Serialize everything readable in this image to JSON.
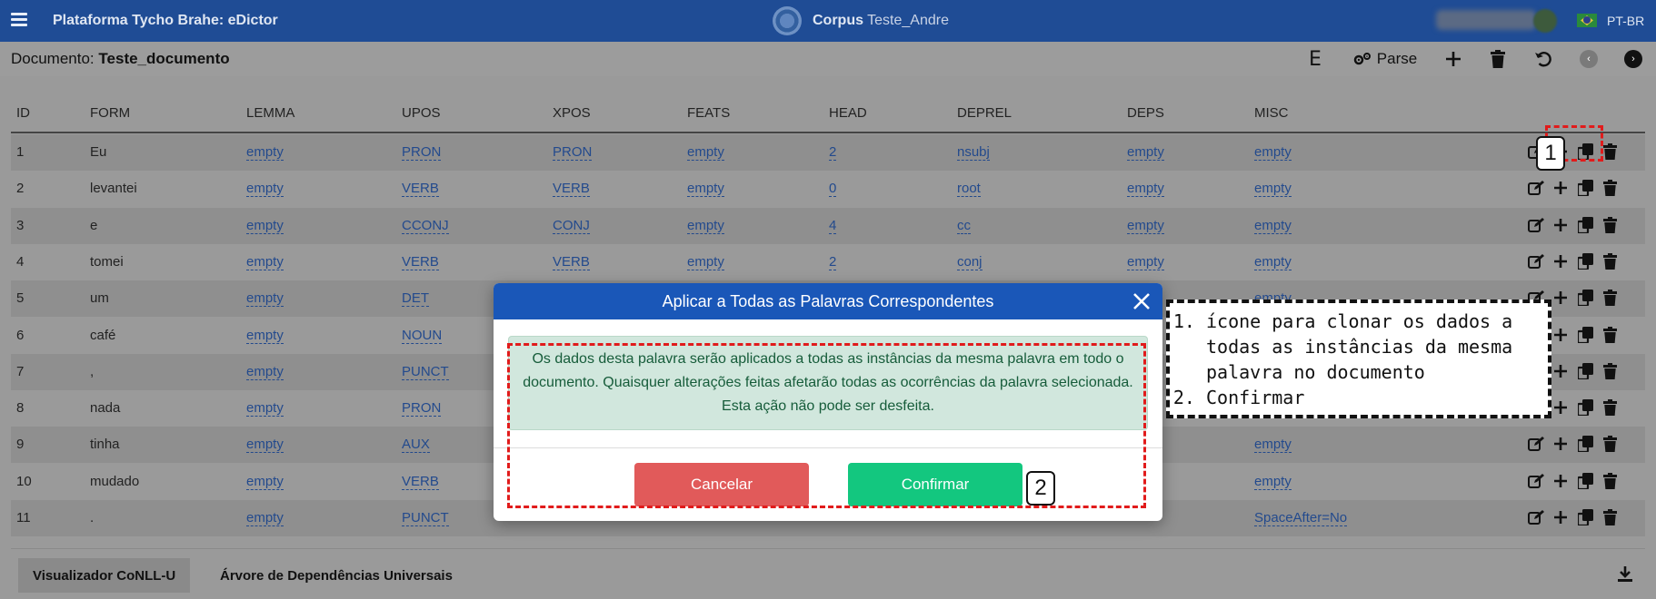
{
  "navbar": {
    "brand": "Plataforma Tycho Brahe: eDictor",
    "corpus_label": "Corpus",
    "corpus_name": "Teste_Andre",
    "lang": "PT-BR"
  },
  "document": {
    "label": "Documento:",
    "name": "Teste_documento"
  },
  "toolbar": {
    "e_label": "E",
    "parse_label": "Parse"
  },
  "table": {
    "headers": [
      "ID",
      "FORM",
      "LEMMA",
      "UPOS",
      "XPOS",
      "FEATS",
      "HEAD",
      "DEPREL",
      "DEPS",
      "MISC"
    ],
    "rows": [
      {
        "id": "1",
        "form": "Eu",
        "lemma": "empty",
        "upos": "PRON",
        "xpos": "PRON",
        "feats": "empty",
        "head": "2",
        "deprel": "nsubj",
        "deps": "empty",
        "misc": "empty"
      },
      {
        "id": "2",
        "form": "levantei",
        "lemma": "empty",
        "upos": "VERB",
        "xpos": "VERB",
        "feats": "empty",
        "head": "0",
        "deprel": "root",
        "deps": "empty",
        "misc": "empty"
      },
      {
        "id": "3",
        "form": "e",
        "lemma": "empty",
        "upos": "CCONJ",
        "xpos": "CONJ",
        "feats": "empty",
        "head": "4",
        "deprel": "cc",
        "deps": "empty",
        "misc": "empty"
      },
      {
        "id": "4",
        "form": "tomei",
        "lemma": "empty",
        "upos": "VERB",
        "xpos": "VERB",
        "feats": "empty",
        "head": "2",
        "deprel": "conj",
        "deps": "empty",
        "misc": "empty"
      },
      {
        "id": "5",
        "form": "um",
        "lemma": "empty",
        "upos": "DET",
        "xpos": "",
        "feats": "",
        "head": "",
        "deprel": "",
        "deps": "",
        "misc": "empty"
      },
      {
        "id": "6",
        "form": "café",
        "lemma": "empty",
        "upos": "NOUN",
        "xpos": "",
        "feats": "",
        "head": "",
        "deprel": "",
        "deps": "",
        "misc": ""
      },
      {
        "id": "7",
        "form": ",",
        "lemma": "empty",
        "upos": "PUNCT",
        "xpos": "",
        "feats": "",
        "head": "",
        "deprel": "",
        "deps": "",
        "misc": ""
      },
      {
        "id": "8",
        "form": "nada",
        "lemma": "empty",
        "upos": "PRON",
        "xpos": "",
        "feats": "",
        "head": "",
        "deprel": "",
        "deps": "",
        "misc": ""
      },
      {
        "id": "9",
        "form": "tinha",
        "lemma": "empty",
        "upos": "AUX",
        "xpos": "",
        "feats": "",
        "head": "",
        "deprel": "",
        "deps": "",
        "misc": "empty"
      },
      {
        "id": "10",
        "form": "mudado",
        "lemma": "empty",
        "upos": "VERB",
        "xpos": "",
        "feats": "",
        "head": "",
        "deprel": "",
        "deps": "",
        "misc": "empty"
      },
      {
        "id": "11",
        "form": ".",
        "lemma": "empty",
        "upos": "PUNCT",
        "xpos": "",
        "feats": "",
        "head": "",
        "deprel": "",
        "deps": "",
        "misc": "SpaceAfter=No"
      }
    ]
  },
  "footer": {
    "tab_conll": "Visualizador CoNLL-U",
    "tab_tree": "Árvore de Dependências Universais"
  },
  "modal": {
    "title": "Aplicar a Todas as Palavras Correspondentes",
    "message": "Os dados desta palavra serão aplicados a todas as instâncias da mesma palavra em todo o documento. Quaisquer alterações feitas afetarão todas as ocorrências da palavra selecionada. Esta ação não pode ser desfeita.",
    "cancel_label": "Cancelar",
    "confirm_label": "Confirmar"
  },
  "annotations": {
    "badge_1": "1",
    "badge_2": "2",
    "note_item_1": "ícone para clonar os dados a todas as instâncias da mesma palavra no documento",
    "note_item_2": "Confirmar"
  },
  "colors": {
    "navbar": "#1f4c95",
    "modal_header": "#1a57b8",
    "alert_bg": "#d1e7dd",
    "cancel": "#e15a5a",
    "confirm": "#13c77f",
    "highlight": "#e11b1b"
  }
}
